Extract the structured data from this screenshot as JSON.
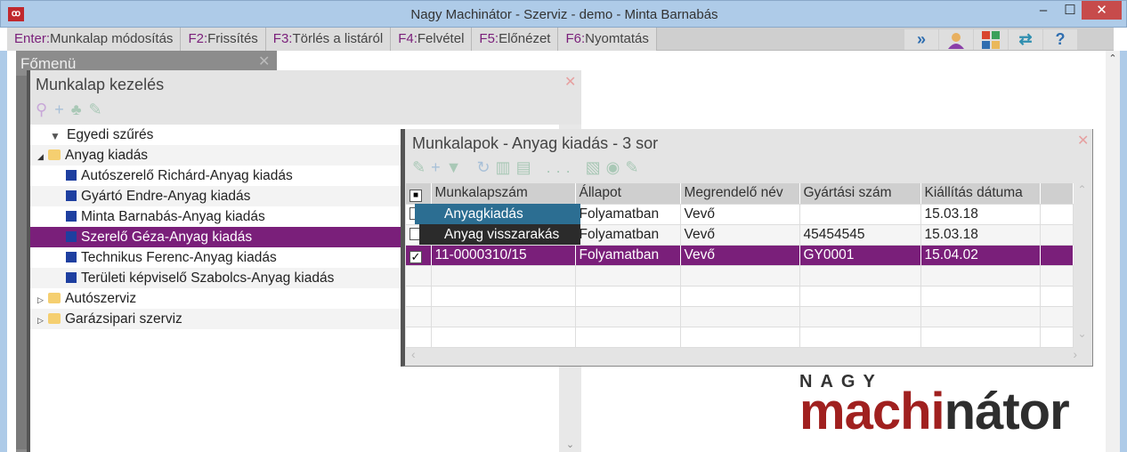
{
  "window": {
    "title": "Nagy Machinátor - Szerviz - demo - Minta Barnabás",
    "minimize": "–",
    "maximize": "☐",
    "close": "✕"
  },
  "toolbar": {
    "keys": [
      {
        "key": "Enter:",
        "label": "Munkalap módosítás"
      },
      {
        "key": "F2:",
        "label": "Frissítés"
      },
      {
        "key": "F3:",
        "label": "Törlés a listáról"
      },
      {
        "key": "F4:",
        "label": "Felvétel"
      },
      {
        "key": "F5:",
        "label": "Előnézet"
      },
      {
        "key": "F6:",
        "label": "Nyomtatás"
      }
    ],
    "icons": [
      "double-chevron-right-icon",
      "user-icon",
      "tiles-icon",
      "swap-arrows-icon",
      "help-icon"
    ]
  },
  "fomenu": {
    "title": "Főmenü",
    "close": "✕"
  },
  "munkalap_kezeles": {
    "title": "Munkalap kezelés",
    "close": "✕",
    "tree": [
      {
        "label": "Egyedi szűrés",
        "type": "filter"
      },
      {
        "label": "Anyag kiadás",
        "type": "folder",
        "expanded": true
      },
      {
        "label": "Autószerelő Richárd-Anyag kiadás",
        "type": "item"
      },
      {
        "label": "Gyártó Endre-Anyag kiadás",
        "type": "item"
      },
      {
        "label": "Minta Barnabás-Anyag kiadás",
        "type": "item"
      },
      {
        "label": "Szerelő Géza-Anyag kiadás",
        "type": "item",
        "selected": true
      },
      {
        "label": "Technikus Ferenc-Anyag kiadás",
        "type": "item"
      },
      {
        "label": "Területi képviselő Szabolcs-Anyag kiadás",
        "type": "item"
      },
      {
        "label": "Autószerviz",
        "type": "folder"
      },
      {
        "label": "Garázsipari szerviz",
        "type": "folder"
      }
    ]
  },
  "munkalapok": {
    "title": "Munkalapok - Anyag kiadás - 3 sor",
    "close": "✕",
    "toolbar_more": "...",
    "columns": [
      "Munkalapszám",
      "Állapot",
      "Megrendelő név",
      "Gyártási szám",
      "Kiállítás dátuma"
    ],
    "rows": [
      {
        "checked": false,
        "szam": "",
        "allapot": "Folyamatban",
        "nev": "Vevő",
        "gyartasi": "",
        "datum": "15.03.18"
      },
      {
        "checked": false,
        "szam": "",
        "allapot": "Folyamatban",
        "nev": "Vevő",
        "gyartasi": "45454545",
        "datum": "15.03.18"
      },
      {
        "checked": true,
        "szam": "11-0000310/15",
        "allapot": "Folyamatban",
        "nev": "Vevő",
        "gyartasi": "GY0001",
        "datum": "15.04.02"
      }
    ]
  },
  "context_menu": {
    "items": [
      "Anyagkiadás",
      "Anyag visszarakás"
    ]
  },
  "logo": {
    "nagy": "NAGY",
    "red": "machi",
    "dark": "nátor"
  },
  "colors": {
    "accent": "#7a1f7a",
    "menu_blue": "#2c6e92",
    "logo_red": "#a0201f"
  }
}
